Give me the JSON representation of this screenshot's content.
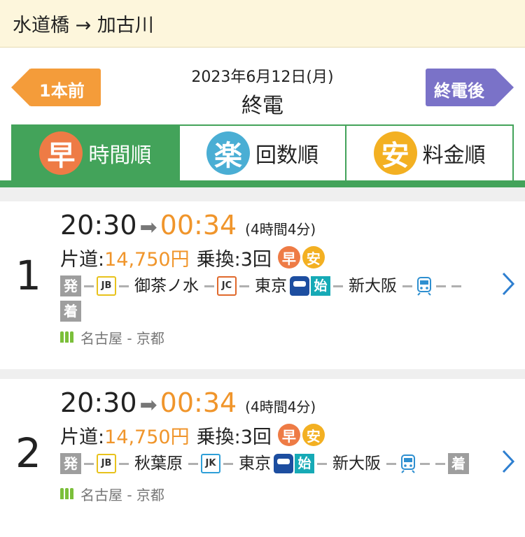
{
  "header": {
    "route_title": "水道橋 → 加古川"
  },
  "date_nav": {
    "prev_label": "1本前",
    "next_label": "終電後",
    "date": "2023年6月12日(月)",
    "subtitle": "終電"
  },
  "sort_tabs": [
    {
      "badge": "早",
      "label": "時間順",
      "color": "#ee7b45",
      "active": true
    },
    {
      "badge": "楽",
      "label": "回数順",
      "color": "#4aaed4",
      "active": false
    },
    {
      "badge": "安",
      "label": "料金順",
      "color": "#f3b022",
      "active": false
    }
  ],
  "results": [
    {
      "number": "1",
      "depart": "20:30",
      "arrow": "➡",
      "arrive": "00:34",
      "duration": "(4時間4分)",
      "fare_label": "片道:",
      "fare": "14,750円",
      "transfer": "乗換:3回",
      "badges": [
        "早",
        "安"
      ],
      "depart_tag": "発",
      "arrive_tag": "着",
      "line1_code": "JB",
      "station1": "御茶ノ水",
      "line2_code": "JC",
      "station2": "東京",
      "start_tag": "始",
      "station3": "新大阪",
      "seat_text": "名古屋 - 京都"
    },
    {
      "number": "2",
      "depart": "20:30",
      "arrow": "➡",
      "arrive": "00:34",
      "duration": "(4時間4分)",
      "fare_label": "片道:",
      "fare": "14,750円",
      "transfer": "乗換:3回",
      "badges": [
        "早",
        "安"
      ],
      "depart_tag": "発",
      "arrive_tag": "着",
      "line1_code": "JB",
      "station1": "秋葉原",
      "line2_code": "JK",
      "station2": "東京",
      "start_tag": "始",
      "station3": "新大阪",
      "seat_text": "名古屋 - 京都"
    }
  ],
  "colors": {
    "accent_green": "#43a35a",
    "orange": "#f0952b",
    "prev_btn": "#f49c3a",
    "next_btn": "#7a72c8",
    "jb": "#e8c21c",
    "jc": "#e0692c",
    "jk": "#2e9fd8",
    "shinkansen": "#1d4ea0"
  }
}
